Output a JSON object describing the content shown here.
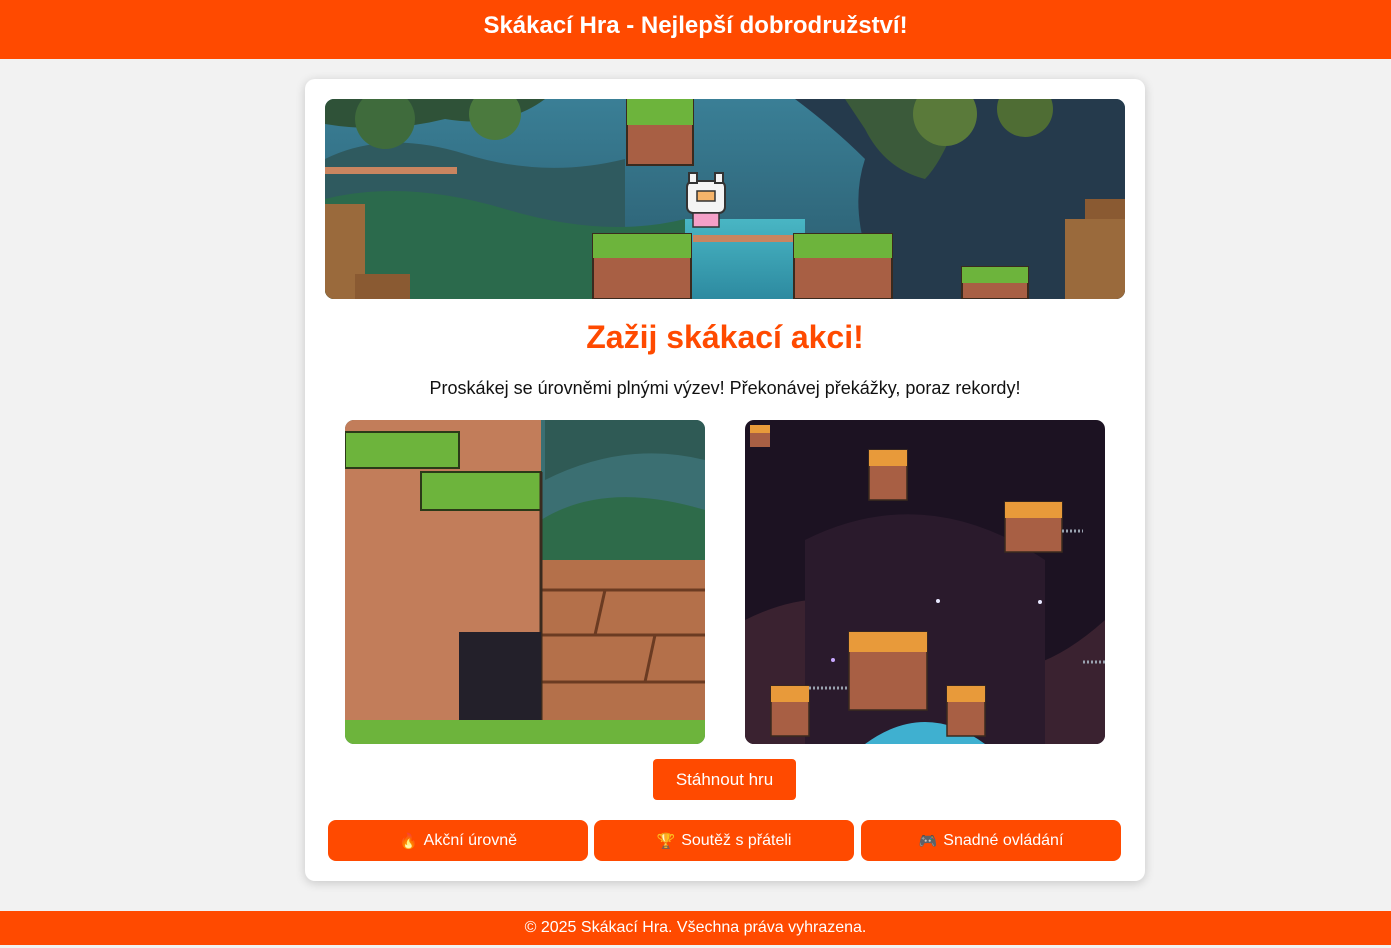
{
  "header": {
    "title": "Skákací Hra - Nejlepší dobrodružství!"
  },
  "main": {
    "headline": "Zažij skákací akci!",
    "subtext": "Proskákej se úrovněmi plnými výzev! Překonávej překážky, poraz rekordy!",
    "download_label": "Stáhnout hru",
    "features": [
      {
        "icon": "🔥",
        "icon_name": "fire-icon",
        "label": "Akční úrovně"
      },
      {
        "icon": "🏆",
        "icon_name": "trophy-icon",
        "label": "Soutěž s přáteli"
      },
      {
        "icon": "🎮",
        "icon_name": "gamepad-icon",
        "label": "Snadné ovládání"
      }
    ]
  },
  "footer": {
    "text": "© 2025 Skákací Hra. Všechna práva vyhrazena."
  },
  "colors": {
    "accent": "#ff4a00",
    "background": "#f2f2f2",
    "card": "#ffffff"
  }
}
